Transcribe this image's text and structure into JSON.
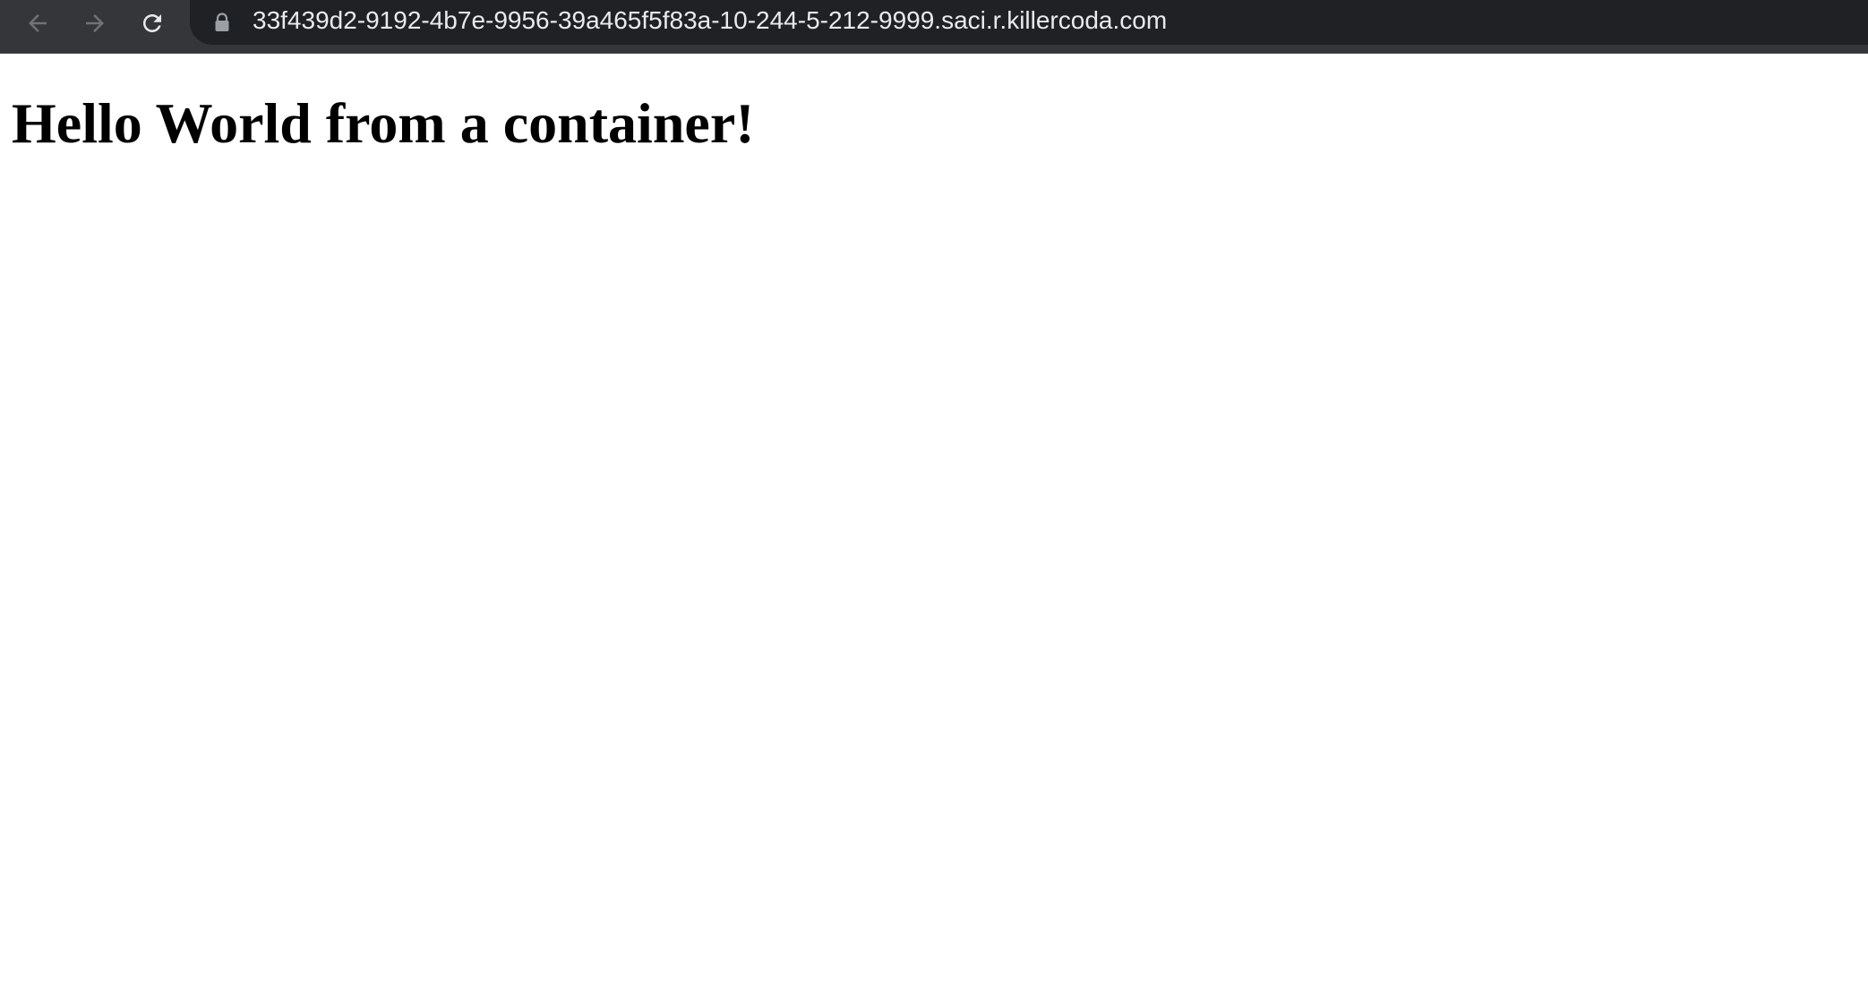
{
  "browser": {
    "toolbar": {
      "background_color": "#35363a",
      "icon_color": "#9aa0a6",
      "reload_icon_color": "#e8eaed",
      "back_icon": "arrow-left-icon",
      "forward_icon": "arrow-right-icon",
      "reload_icon": "reload-icon"
    },
    "address_bar": {
      "background_color": "#202124",
      "lock_icon": "lock-icon",
      "url": "33f439d2-9192-4b7e-9956-39a465f5f83a-10-244-5-212-9999.saci.r.killercoda.com"
    }
  },
  "page": {
    "background_color": "#ffffff",
    "heading": "Hello World from a container!"
  }
}
